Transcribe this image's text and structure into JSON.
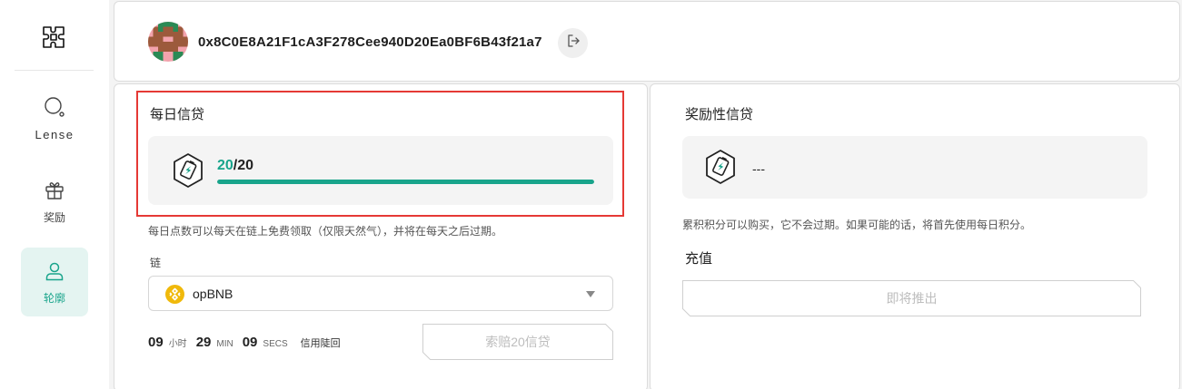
{
  "sidebar": {
    "logo_icon": "puzzle-logo-icon",
    "items": [
      {
        "label": "Lense",
        "icon": "lens-search-icon",
        "active": false
      },
      {
        "label": "奖励",
        "icon": "gift-icon",
        "active": false
      },
      {
        "label": "轮廓",
        "icon": "user-profile-icon",
        "active": true
      }
    ]
  },
  "header": {
    "wallet_address": "0x8C0E8A21F1cA3F278Cee940D20Ea0BF6B43f21a7",
    "logout_icon": "logout-icon"
  },
  "daily_credits": {
    "title": "每日信贷",
    "current": "20",
    "max": "/20",
    "progress_fraction": 1.0,
    "description": "每日点数可以每天在链上免费领取（仅限天然气），并将在每天之后过期。",
    "chain_label": "链",
    "chain_selected": "opBNB",
    "countdown": {
      "hours": "09",
      "hours_unit": "小时",
      "minutes": "29",
      "minutes_unit": "MIN",
      "seconds": "09",
      "seconds_unit": "SECS",
      "status": "信用陡回"
    },
    "claim_button": "索赔20信贷"
  },
  "bonus_credits": {
    "title": "奖励性信贷",
    "value": "---",
    "description": "累积积分可以购买，它不会过期。如果可能的话，将首先使用每日积分。",
    "recharge_title": "充值",
    "coming_soon_button": "即将推出"
  },
  "colors": {
    "accent": "#18a48b",
    "highlight_border": "#e53935",
    "chain_icon": "#f0b90b",
    "disabled_text": "#bdbdbd"
  }
}
